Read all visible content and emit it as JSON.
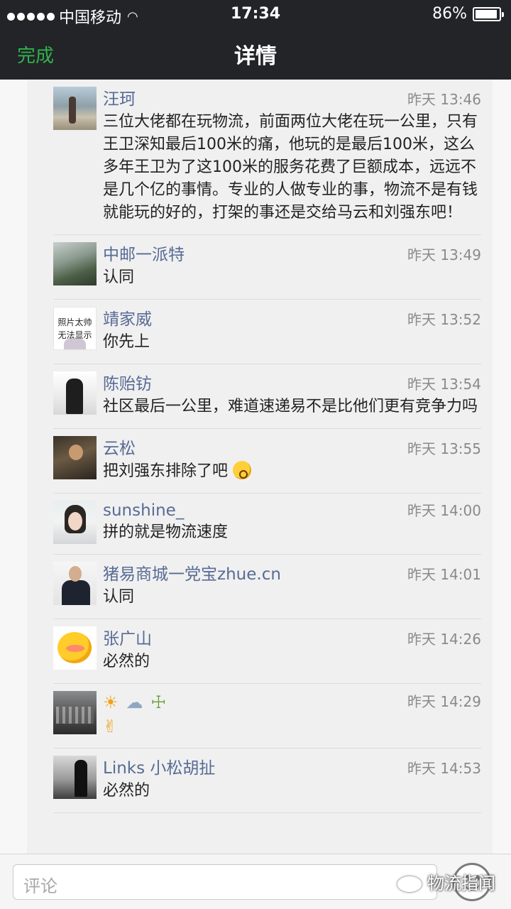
{
  "status_bar": {
    "carrier": "中国移动",
    "time": "17:34",
    "battery": "86%",
    "battery_level": 0.86
  },
  "nav": {
    "done_label": "完成",
    "title": "详情"
  },
  "comments": [
    {
      "name": "汪珂",
      "time": "昨天 13:46",
      "text": "三位大佬都在玩物流，前面两位大佬在玩一公里，只有王卫深知最后100米的痛，他玩的是最后100米，这么多年王卫为了这100米的服务花费了巨额成本，远远不是几个亿的事情。专业的人做专业的事，物流不是有钱就能玩的好的，打架的事还是交给马云和刘强东吧！"
    },
    {
      "name": "中邮一派特",
      "time": "昨天 13:49",
      "text": "认同"
    },
    {
      "name": "靖家威",
      "time": "昨天 13:52",
      "text": "你先上",
      "avatar_text_1": "照片太帅",
      "avatar_text_2": "无法显示"
    },
    {
      "name": "陈贻钫",
      "time": "昨天 13:54",
      "text": "社区最后一公里，难道速递易不是比他们更有竞争力吗"
    },
    {
      "name": "云松",
      "time": "昨天 13:55",
      "text": "把刘强东排除了吧",
      "emoji": "blush-emoji"
    },
    {
      "name": "sunshine_",
      "time": "昨天 14:00",
      "text": "拼的就是物流速度"
    },
    {
      "name": "猪易商城一党宝zhue.cn",
      "time": "昨天 14:01",
      "text": "认同"
    },
    {
      "name": "张广山",
      "time": "昨天 14:26",
      "text": "必然的"
    },
    {
      "name": "",
      "time": "昨天 14:29",
      "emojis": [
        "sun-emoji",
        "cloud-emoji",
        "cocktail-emoji",
        "thumbs-up-emoji"
      ]
    },
    {
      "name": "Links 小松胡扯",
      "time": "昨天 14:53",
      "text": "必然的"
    }
  ],
  "footer": {
    "comment_placeholder": "评论",
    "watermark": "物流指闻"
  },
  "colors": {
    "nav_bg": "#232428",
    "done_green": "#2fb34a",
    "name_blue": "#576b95"
  }
}
